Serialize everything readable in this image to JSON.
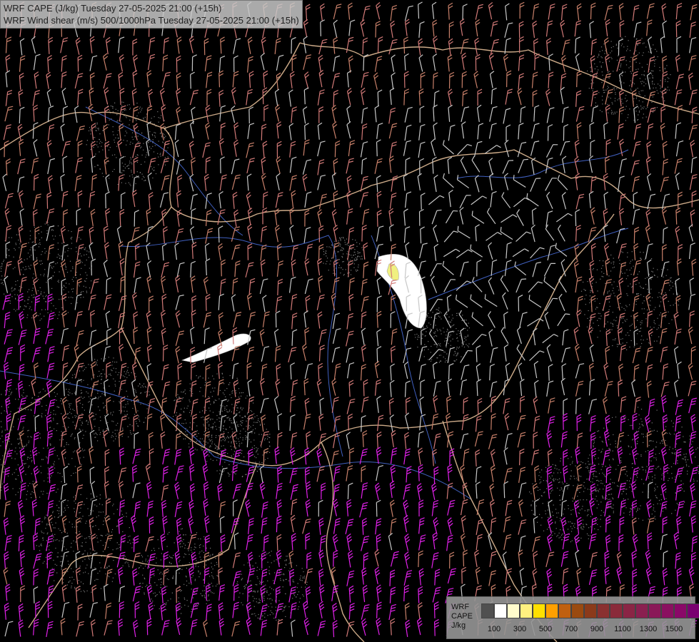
{
  "header": {
    "line1": "WRF CAPE (J/kg) Tuesday 27-05-2025 21:00 (+15h)",
    "line2": "WRF Wind shear (m/s) 500/1000hPa Tuesday 27-05-2025 21:00 (+15h)"
  },
  "legend": {
    "title1": "WRF",
    "title2": "CAPE",
    "title3": "J/kg",
    "ticks": [
      "100",
      "300",
      "500",
      "700",
      "900",
      "1100",
      "1300",
      "1500"
    ],
    "colors": [
      "#505050",
      "#ffffff",
      "#fffccc",
      "#fff080",
      "#ffe000",
      "#ffa000",
      "#c06010",
      "#9a4a10",
      "#8b3a1a",
      "#8a3030",
      "#8a2a3a",
      "#8a2545",
      "#8a2050",
      "#8a1858",
      "#8a1060",
      "#8a0868",
      "#7a0070"
    ]
  },
  "colors": {
    "barb_low": "#c8c8c8",
    "barb_mid": "#c8806a",
    "barb_high": "#d27a78",
    "barb_extreme": "#e020e8",
    "border": "#f0c8a0",
    "river": "#4060c0"
  }
}
